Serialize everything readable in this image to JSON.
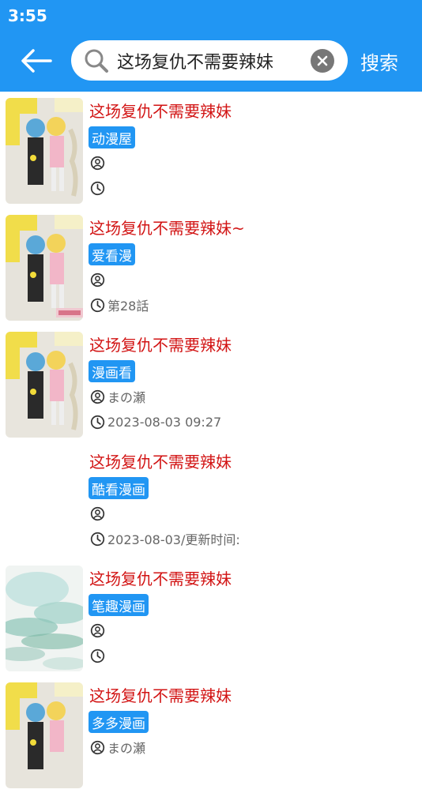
{
  "status_bar": {
    "time": "3:55"
  },
  "toolbar": {
    "search_query": "这场复仇不需要辣妹",
    "search_button_label": "搜索"
  },
  "results": [
    {
      "title": "这场复仇不需要辣妹",
      "source": "动漫屋",
      "author": "",
      "update": ""
    },
    {
      "title": "这场复仇不需要辣妹~",
      "source": "爱看漫",
      "author": "",
      "update": "第28話"
    },
    {
      "title": "这场复仇不需要辣妹",
      "source": "漫画看",
      "author": "まの瀬",
      "update": "2023-08-03 09:27"
    },
    {
      "title": "这场复仇不需要辣妹",
      "source": "酷看漫画",
      "author": "",
      "update": "2023-08-03/更新时间:"
    },
    {
      "title": "这场复仇不需要辣妹",
      "source": "笔趣漫画",
      "author": "",
      "update": ""
    },
    {
      "title": "这场复仇不需要辣妹",
      "source": "多多漫画",
      "author": "まの瀬",
      "update": ""
    }
  ],
  "colors": {
    "accent": "#2196f3",
    "title_red": "#d21414",
    "meta_gray": "#666666"
  },
  "icons": {
    "back": "arrow-left-icon",
    "search": "magnifier-icon",
    "clear": "clear-circle-icon",
    "author": "person-circle-icon",
    "update": "clock-icon"
  }
}
